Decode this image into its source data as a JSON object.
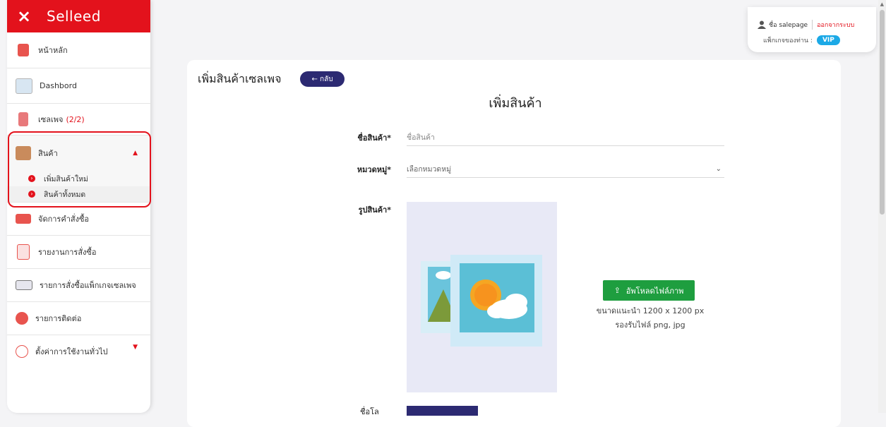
{
  "brand": {
    "close_icon": "×",
    "name": "Selleed",
    "color": "#e3121c"
  },
  "sidebar": {
    "items": [
      {
        "label": "หน้าหลัก"
      },
      {
        "label": "Dashbord"
      },
      {
        "label": "เซลเพจ",
        "count": "(2/2)"
      },
      {
        "label": "สินค้า",
        "arrow": "▲"
      },
      {
        "label": "จัดการคำสั่งซื้อ"
      },
      {
        "label": "รายงานการสั่งซื้อ"
      },
      {
        "label": "รายการสั่งซื้อแพ็กเกจเซลเพจ"
      },
      {
        "label": "รายการติดต่อ"
      },
      {
        "label": "ตั้งค่าการใช้งานทั่วไป",
        "arrow": "▼"
      }
    ],
    "submenu": [
      {
        "label": "เพิ่มสินค้าใหม่"
      },
      {
        "label": "สินค้าทั้งหมด"
      }
    ]
  },
  "user": {
    "name": "ชื่อ salepage",
    "logout": "ออกจากระบบ",
    "package_label": "แพ็กเกจของท่าน :",
    "package": "VIP"
  },
  "page": {
    "title": "เพิ่มสินค้าเซลเพจ",
    "back_label": "← กลับ",
    "form_title": "เพิ่มสินค้า"
  },
  "form": {
    "name_label": "ชื่อสินค้า*",
    "name_placeholder": "ชื่อสินค้า",
    "category_label": "หมวดหมู่*",
    "category_value": "เลือกหมวดหมู่",
    "image_label": "รูปสินค้า*",
    "upload_label": "อัพโหลดไฟล์ภาพ",
    "upload_size": "ขนาดแนะนำ 1200 x 1200 px",
    "upload_types": "รองรับไฟล์ png, jpg",
    "bottom_label": "ชื่อโล"
  },
  "icons": {
    "close": "close-icon",
    "user": "user-icon",
    "upload": "upload-icon",
    "chevron": "chevron-down-icon",
    "placeholder": "image-placeholder-icon"
  }
}
